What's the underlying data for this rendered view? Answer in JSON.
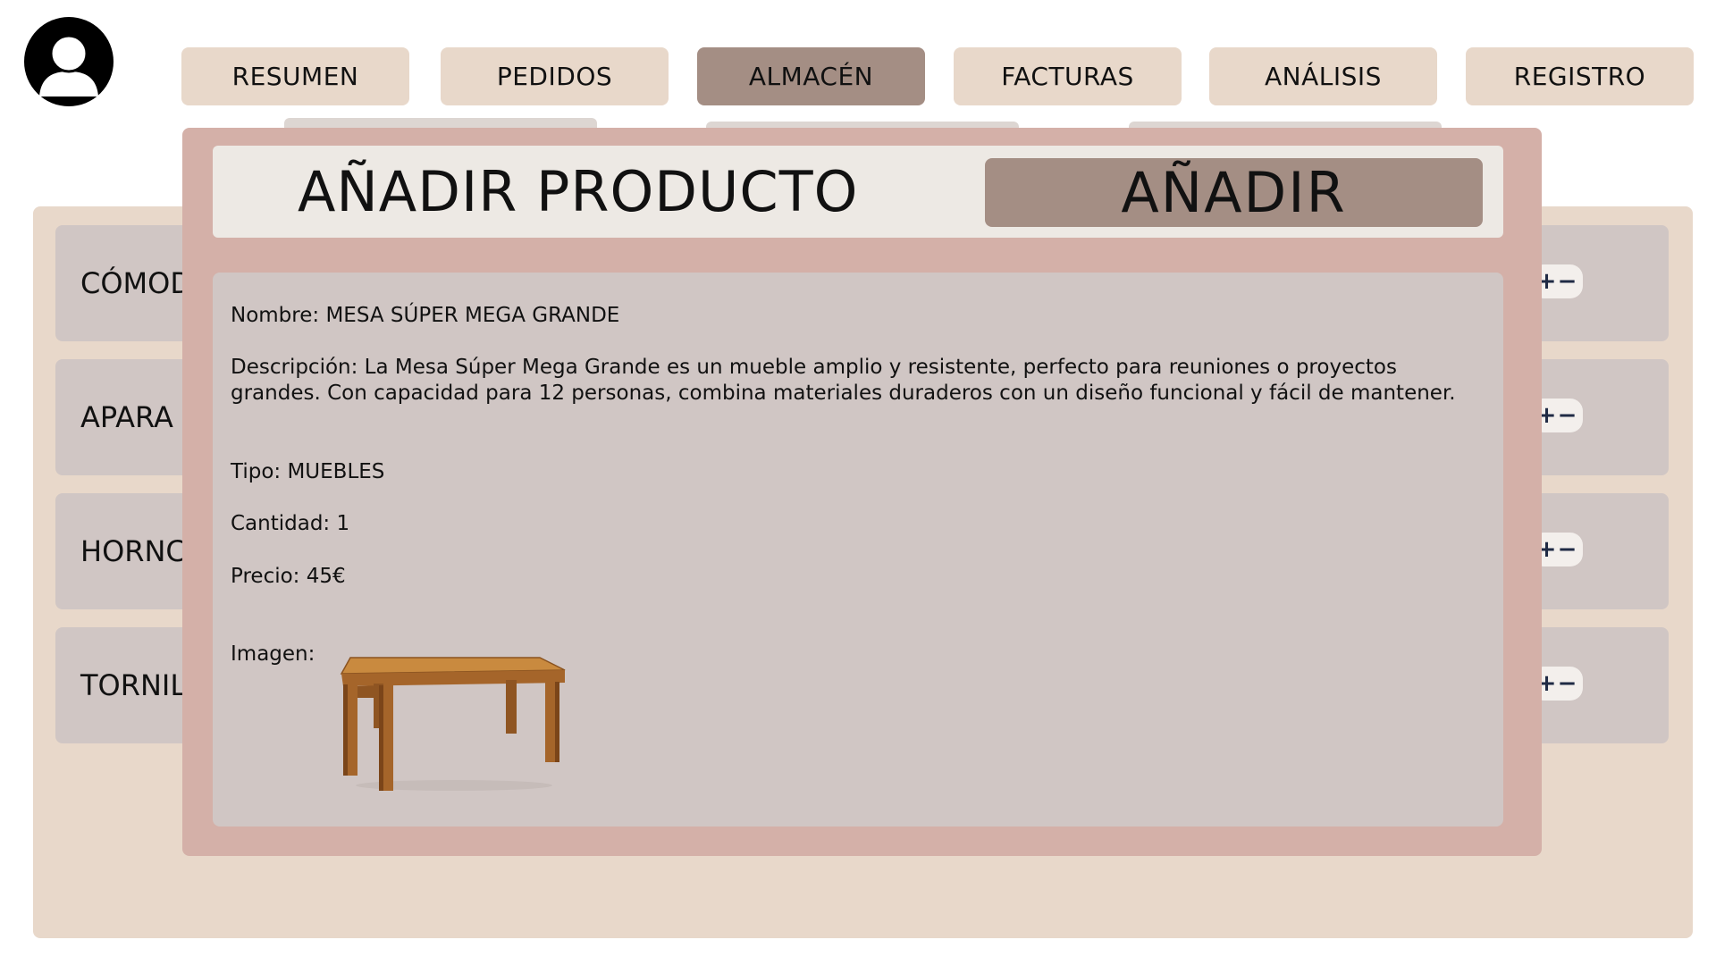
{
  "nav": {
    "items": [
      {
        "label": "RESUMEN"
      },
      {
        "label": "PEDIDOS"
      },
      {
        "label": "ALMACÉN"
      },
      {
        "label": "FACTURAS"
      },
      {
        "label": "ANÁLISIS"
      },
      {
        "label": "REGISTRO"
      }
    ],
    "active": "ALMACÉN"
  },
  "inventory": {
    "rows": [
      {
        "label": "CÓMOD"
      },
      {
        "label": "APARA"
      },
      {
        "label": "HORNC"
      },
      {
        "label": "TORNIL"
      }
    ],
    "stepper_plus": "+",
    "stepper_minus": "−"
  },
  "modal": {
    "title": "AÑADIR PRODUCTO",
    "add_button": "AÑADIR",
    "fields": {
      "name": "Nombre: MESA SÚPER MEGA GRANDE",
      "description": "Descripción: La Mesa Súper Mega Grande es un mueble amplio y resistente, perfecto para reuniones o proyectos grandes. Con capacidad para 12 personas, combina materiales duraderos con un diseño funcional y fácil de mantener.",
      "type": "Tipo: MUEBLES",
      "quantity": "Cantidad: 1",
      "price": "Precio: 45€",
      "image_label": "Imagen:"
    }
  },
  "colors": {
    "nav_bg": "#e8d8ca",
    "nav_active": "#a48e84",
    "panel_bg": "#e8d8ca",
    "row_bg": "#d0c6c4",
    "modal_bg": "#d4b0a8",
    "modal_header_bg": "#ede9e4"
  },
  "icons": {
    "avatar": "user-avatar-icon",
    "product_image": "wooden-table-image"
  }
}
